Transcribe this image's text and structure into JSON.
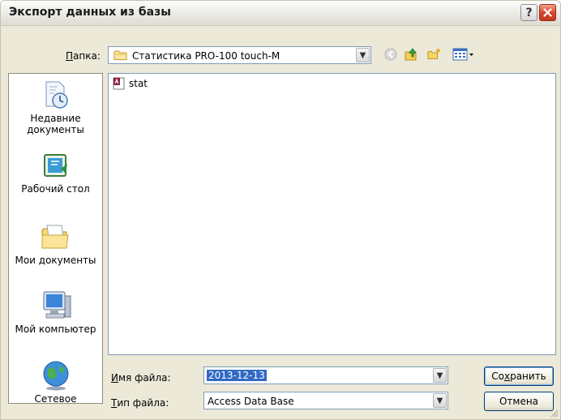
{
  "window": {
    "title": "Экспорт данных из базы"
  },
  "titlebar": {
    "help_label": "?"
  },
  "folder": {
    "label_u": "П",
    "label_rest": "апка:",
    "value": "Статистика PRO-100 touch-M"
  },
  "places": [
    {
      "label": "Недавние документы"
    },
    {
      "label": "Рабочий стол"
    },
    {
      "label": "Мои документы"
    },
    {
      "label": "Мой компьютер"
    },
    {
      "label": "Сетевое"
    }
  ],
  "files": [
    {
      "name": "stat"
    }
  ],
  "filename": {
    "label_u": "И",
    "label_rest": "мя файла:",
    "value": "2013-12-13"
  },
  "filetype": {
    "label_u": "Т",
    "label_rest": "ип файла:",
    "value": "Access Data Base"
  },
  "buttons": {
    "save_pre": "Со",
    "save_u": "х",
    "save_post": "ранить",
    "cancel": "Отмена"
  },
  "colors": {
    "accent": "#316ac5",
    "close": "#d8472b",
    "border": "#7f9db9"
  }
}
